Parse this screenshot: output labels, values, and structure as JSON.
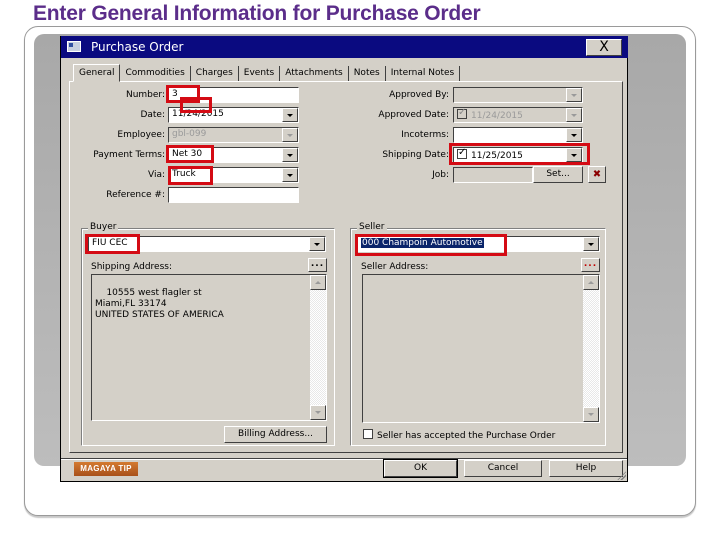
{
  "slide": {
    "title": "Enter General Information for Purchase Order"
  },
  "dialog": {
    "title": "Purchase Order",
    "close_label": "X",
    "tabs": [
      {
        "label": "General",
        "active": true
      },
      {
        "label": "Commodities"
      },
      {
        "label": "Charges"
      },
      {
        "label": "Events"
      },
      {
        "label": "Attachments"
      },
      {
        "label": "Notes"
      },
      {
        "label": "Internal Notes"
      }
    ],
    "left_fields": {
      "number": {
        "label": "Number:",
        "value": "3"
      },
      "date": {
        "label": "Date:",
        "value": "11/24/2015"
      },
      "employee": {
        "label": "Employee:",
        "value": "gbl-099"
      },
      "payment_terms": {
        "label": "Payment Terms:",
        "value": "Net 30"
      },
      "via": {
        "label": "Via:",
        "value": "Truck"
      },
      "reference": {
        "label": "Reference #:",
        "value": ""
      }
    },
    "right_fields": {
      "approved_by": {
        "label": "Approved By:",
        "value": ""
      },
      "approved_date": {
        "label": "Approved Date:",
        "value": "11/24/2015",
        "checked": true
      },
      "incoterms": {
        "label": "Incoterms:",
        "value": ""
      },
      "shipping_date": {
        "label": "Shipping Date:",
        "value": "11/25/2015",
        "checked": true
      },
      "job": {
        "label": "Job:",
        "value": "",
        "set_label": "Set..."
      }
    },
    "buyer": {
      "group_title": "Buyer",
      "name": "FIU CEC",
      "shipping_address_label": "Shipping Address:",
      "address_lines": "10555 west flagler st\nMiami,FL 33174\nUNITED STATES OF AMERICA",
      "billing_button": "Billing Address...",
      "dots_label": "..."
    },
    "seller": {
      "group_title": "Seller",
      "name": "000 Champoin Automotive",
      "address_label": "Seller Address:",
      "address_lines": "",
      "accepted_label": "Seller has accepted the Purchase Order",
      "accepted": false,
      "dots_label": "..."
    },
    "footer": {
      "tip_label": "MAGAYA TIP",
      "ok": "OK",
      "cancel": "Cancel",
      "help": "Help"
    },
    "highlight_color": "#d40b14"
  }
}
